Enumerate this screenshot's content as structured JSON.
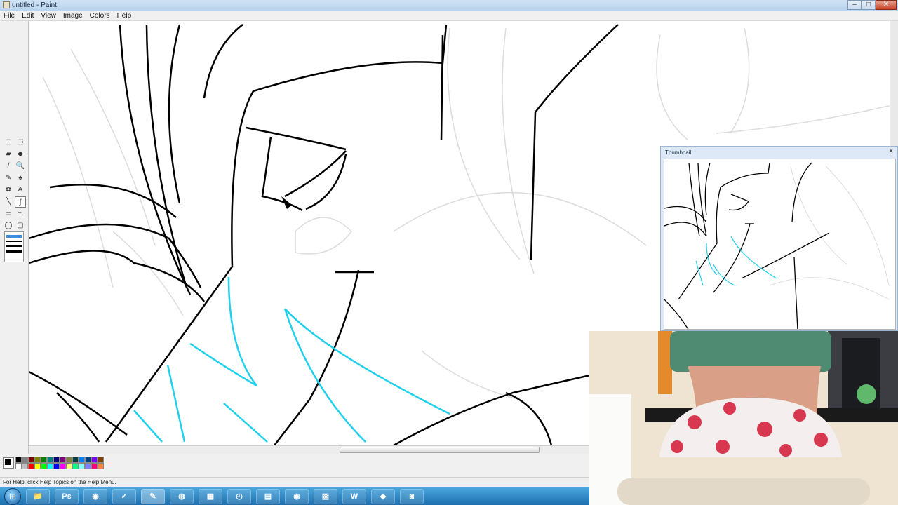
{
  "window": {
    "title": "untitled - Paint",
    "controls": {
      "minimize": "–",
      "maximize": "□",
      "close": "✕"
    }
  },
  "menu": [
    "File",
    "Edit",
    "View",
    "Image",
    "Colors",
    "Help"
  ],
  "toolbox": {
    "tools": [
      {
        "name": "free-form-select",
        "glyph": "⬚"
      },
      {
        "name": "select",
        "glyph": "⬚"
      },
      {
        "name": "eraser",
        "glyph": "▰"
      },
      {
        "name": "fill",
        "glyph": "◆"
      },
      {
        "name": "pick-color",
        "glyph": "/"
      },
      {
        "name": "magnifier",
        "glyph": "🔍"
      },
      {
        "name": "pencil",
        "glyph": "✎"
      },
      {
        "name": "brush",
        "glyph": "♠"
      },
      {
        "name": "airbrush",
        "glyph": "✿"
      },
      {
        "name": "text",
        "glyph": "A"
      },
      {
        "name": "line",
        "glyph": "╲"
      },
      {
        "name": "curve",
        "glyph": "∫"
      },
      {
        "name": "rectangle",
        "glyph": "▭"
      },
      {
        "name": "polygon",
        "glyph": "⏢"
      },
      {
        "name": "ellipse",
        "glyph": "◯"
      },
      {
        "name": "rounded-rectangle",
        "glyph": "▢"
      }
    ],
    "active_tool": "curve"
  },
  "palette": {
    "colors": [
      "#000000",
      "#808080",
      "#800000",
      "#808000",
      "#008000",
      "#008080",
      "#000080",
      "#800080",
      "#808040",
      "#004040",
      "#0080ff",
      "#004080",
      "#8000ff",
      "#804000",
      "#ffffff",
      "#c0c0c0",
      "#ff0000",
      "#ffff00",
      "#00ff00",
      "#00ffff",
      "#0000ff",
      "#ff00ff",
      "#ffff80",
      "#00ff80",
      "#80ffff",
      "#8080ff",
      "#ff0080",
      "#ff8040"
    ]
  },
  "status": {
    "help_text": "For Help, click Help Topics on the Help Menu."
  },
  "thumbnail": {
    "title": "Thumbnail"
  },
  "taskbar": {
    "apps": [
      {
        "name": "explorer",
        "glyph": "📁"
      },
      {
        "name": "photoshop",
        "glyph": "Ps"
      },
      {
        "name": "chrome",
        "glyph": "◉"
      },
      {
        "name": "norton",
        "glyph": "✓"
      },
      {
        "name": "paint-tool",
        "glyph": "✎"
      },
      {
        "name": "firefox",
        "glyph": "◍"
      },
      {
        "name": "excel",
        "glyph": "▦"
      },
      {
        "name": "clock",
        "glyph": "◴"
      },
      {
        "name": "notepad",
        "glyph": "▤"
      },
      {
        "name": "blender",
        "glyph": "◉"
      },
      {
        "name": "files",
        "glyph": "▨"
      },
      {
        "name": "web",
        "glyph": "W"
      },
      {
        "name": "git",
        "glyph": "◆"
      },
      {
        "name": "recorder",
        "glyph": "◙"
      }
    ]
  }
}
